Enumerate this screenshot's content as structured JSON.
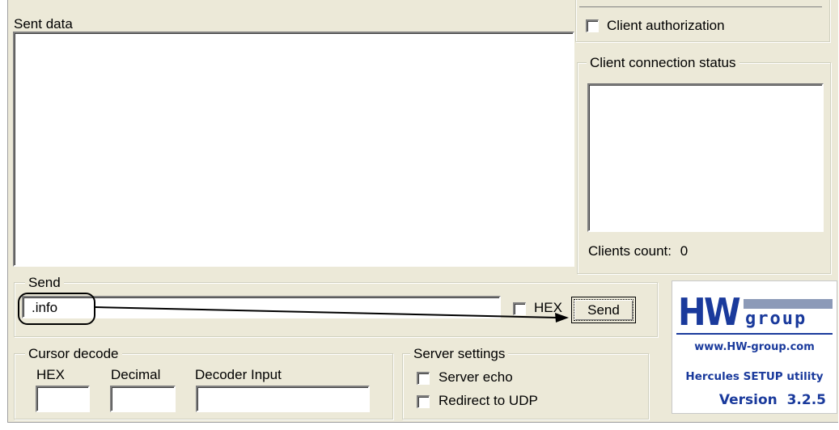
{
  "sent_data": {
    "label": "Sent data",
    "content": ""
  },
  "client_authorization": {
    "label": "Client authorization",
    "checked": false
  },
  "client_connection_status": {
    "label": "Client connection status",
    "clients_count_label": "Clients count:",
    "clients_count_value": "0"
  },
  "send": {
    "group_label": "Send",
    "input_value": ".info",
    "hex_label": "HEX",
    "hex_checked": false,
    "send_button_label": "Send"
  },
  "cursor_decode": {
    "group_label": "Cursor decode",
    "hex_label": "HEX",
    "decimal_label": "Decimal",
    "decoder_input_label": "Decoder Input",
    "hex_value": "",
    "decimal_value": "",
    "decoder_input_value": ""
  },
  "server_settings": {
    "group_label": "Server settings",
    "server_echo_label": "Server echo",
    "server_echo_checked": false,
    "redirect_udp_label": "Redirect to UDP",
    "redirect_udp_checked": false
  },
  "logo": {
    "brand_h": "HW",
    "brand_group": "group",
    "website": "www.HW-group.com",
    "product": "Hercules SETUP utility",
    "version": "Version  3.2.5"
  },
  "colors": {
    "panel_bg": "#ece9d8",
    "logo_blue": "#1a3a9c",
    "logo_gray": "#8c9ab8"
  }
}
